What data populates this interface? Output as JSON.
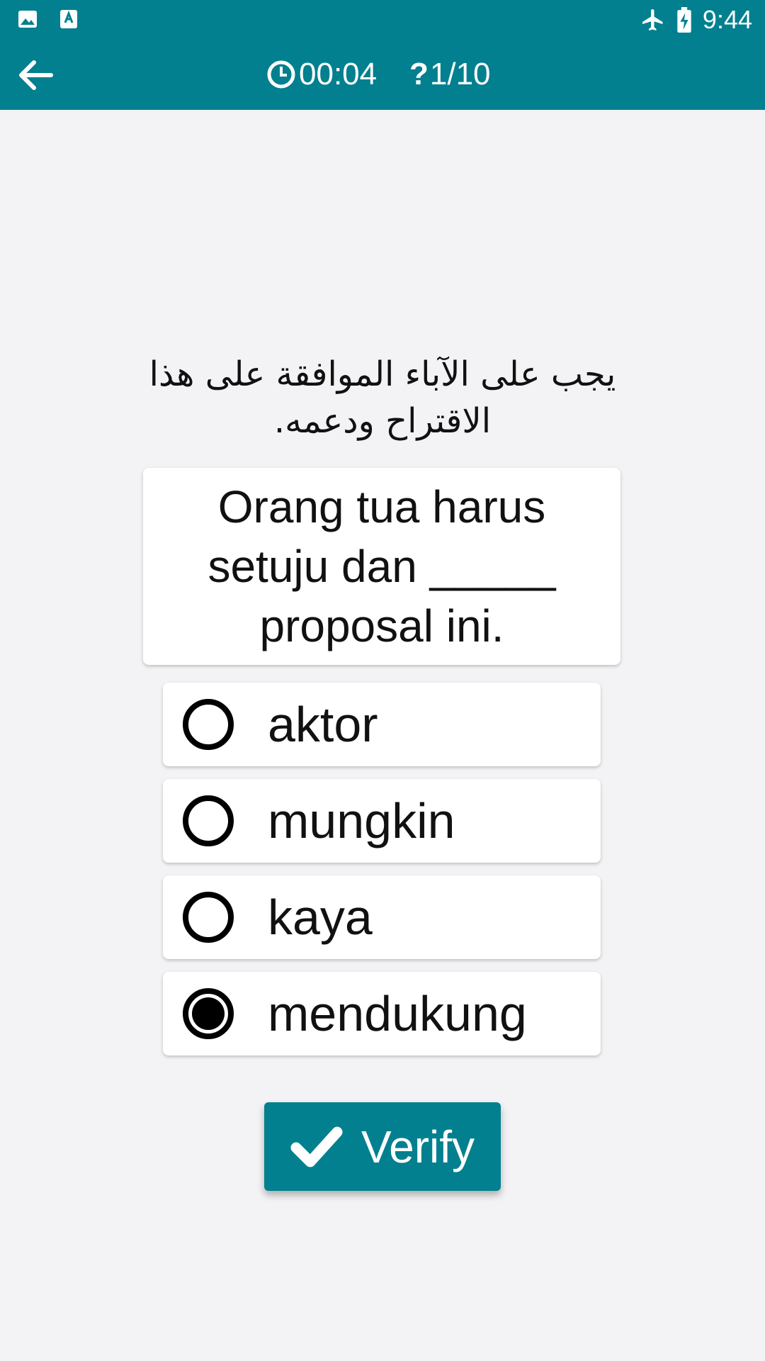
{
  "status_bar": {
    "time": "9:44",
    "icons": [
      "image-icon",
      "font-icon",
      "airplane-icon",
      "battery-charging-icon"
    ]
  },
  "app_bar": {
    "back_icon": "back-arrow-icon",
    "timer_icon": "clock-icon",
    "timer": "00:04",
    "question_icon": "question-mark-icon",
    "question_mark": "?",
    "progress": "1/10"
  },
  "quiz": {
    "prompt_arabic": "يجب على الآباء الموافقة على هذا الاقتراح ودعمه.",
    "question": "Orang tua harus setuju dan _____ proposal ini.",
    "options": [
      {
        "label": "aktor",
        "selected": false
      },
      {
        "label": "mungkin",
        "selected": false
      },
      {
        "label": "kaya",
        "selected": false
      },
      {
        "label": "mendukung",
        "selected": true
      }
    ]
  },
  "actions": {
    "verify_label": "Verify",
    "verify_icon": "checkmark-icon"
  },
  "colors": {
    "primary": "#02808f",
    "background": "#f3f2f4"
  }
}
